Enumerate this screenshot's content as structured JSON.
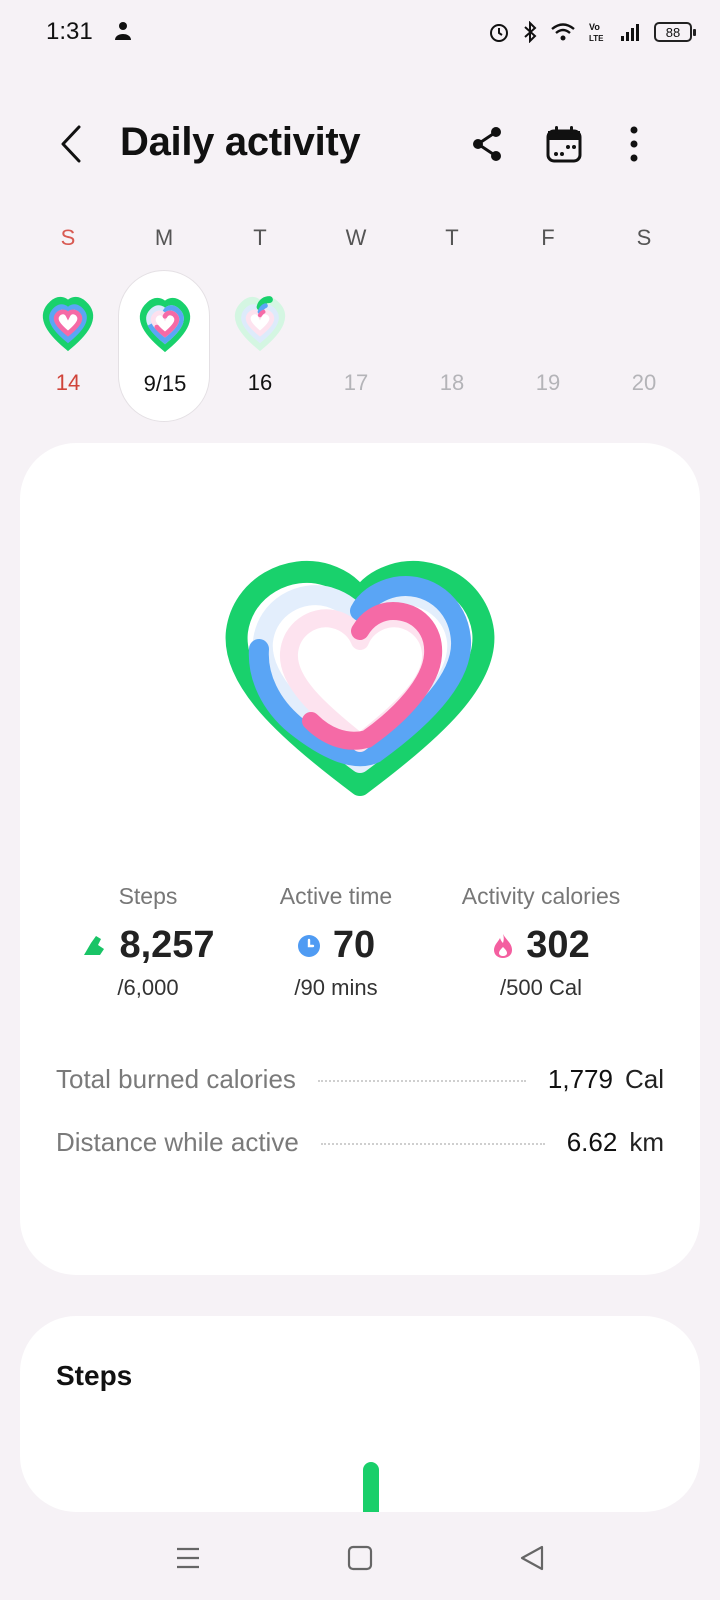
{
  "status_bar": {
    "time": "1:31",
    "battery": "88",
    "icons": [
      "person-icon",
      "alarm-icon",
      "bluetooth-icon",
      "wifi-icon",
      "volte-icon",
      "signal-icon",
      "battery-icon"
    ]
  },
  "header": {
    "title": "Daily activity",
    "back_icon": "chevron-left-icon",
    "share_icon": "share-icon",
    "calendar_icon": "calendar-icon",
    "more_icon": "more-vertical-icon"
  },
  "week": {
    "days": [
      {
        "dow": "S",
        "num": "14"
      },
      {
        "dow": "M",
        "num": "9/15"
      },
      {
        "dow": "T",
        "num": "16"
      },
      {
        "dow": "W",
        "num": "17"
      },
      {
        "dow": "T",
        "num": "18"
      },
      {
        "dow": "F",
        "num": "19"
      },
      {
        "dow": "S",
        "num": "20"
      }
    ]
  },
  "summary": {
    "steps": {
      "label": "Steps",
      "value": "8,257",
      "goal": "/6,000"
    },
    "active_time": {
      "label": "Active time",
      "value": "70",
      "goal": "/90 mins"
    },
    "calories": {
      "label": "Activity calories",
      "value": "302",
      "goal": "/500 Cal"
    },
    "total_burned": {
      "label": "Total burned calories",
      "value": "1,779",
      "unit": "Cal"
    },
    "distance": {
      "label": "Distance while active",
      "value": "6.62",
      "unit": "km"
    }
  },
  "steps_card": {
    "title": "Steps"
  },
  "colors": {
    "steps_ring": "#19d16c",
    "active_ring": "#5aa5f5",
    "calories_ring": "#f56aa6",
    "accent_red": "#d0443a"
  }
}
